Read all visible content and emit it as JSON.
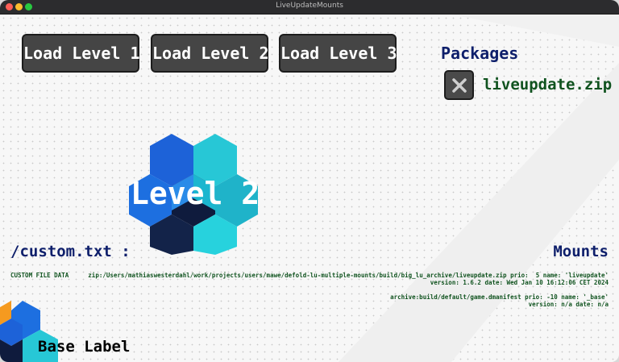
{
  "window": {
    "title": "LiveUpdateMounts"
  },
  "buttons": [
    {
      "label": "Load Level 1"
    },
    {
      "label": "Load Level 2"
    },
    {
      "label": "Load Level 3"
    }
  ],
  "packages": {
    "title": "Packages",
    "items": [
      {
        "name": "liveupdate.zip",
        "remove_icon": "close-icon"
      }
    ]
  },
  "level": {
    "label": "Level 2",
    "logo_icon": "defold-logo-icon"
  },
  "custom": {
    "title": "/custom.txt :",
    "data": "CUSTOM FILE DATA"
  },
  "mounts": {
    "title": "Mounts",
    "entries": [
      {
        "line1": "zip:/Users/mathiaswesterdahl/work/projects/users/mawe/defold-lu-multiple-mounts/build/big_lu_archive/liveupdate.zip prio:  5 name: 'liveupdate'",
        "line2": "version: 1.6.2 date: Wed Jan 10 16:12:06 CET 2024"
      },
      {
        "line1": "archive:build/default/game.dmanifest prio: -10 name: '_base'",
        "line2": "version: n/a date: n/a"
      }
    ]
  },
  "base": {
    "label": "Base Label",
    "logo_icon": "defold-logo-icon"
  },
  "colors": {
    "heading": "#0e1f6b",
    "text_green": "#10531f",
    "button_bg": "#454545",
    "logo_blue": "#1d6fe0",
    "logo_cyan": "#27c7d6",
    "logo_dark": "#0f1b3d",
    "logo_orange": "#f59a1f"
  }
}
